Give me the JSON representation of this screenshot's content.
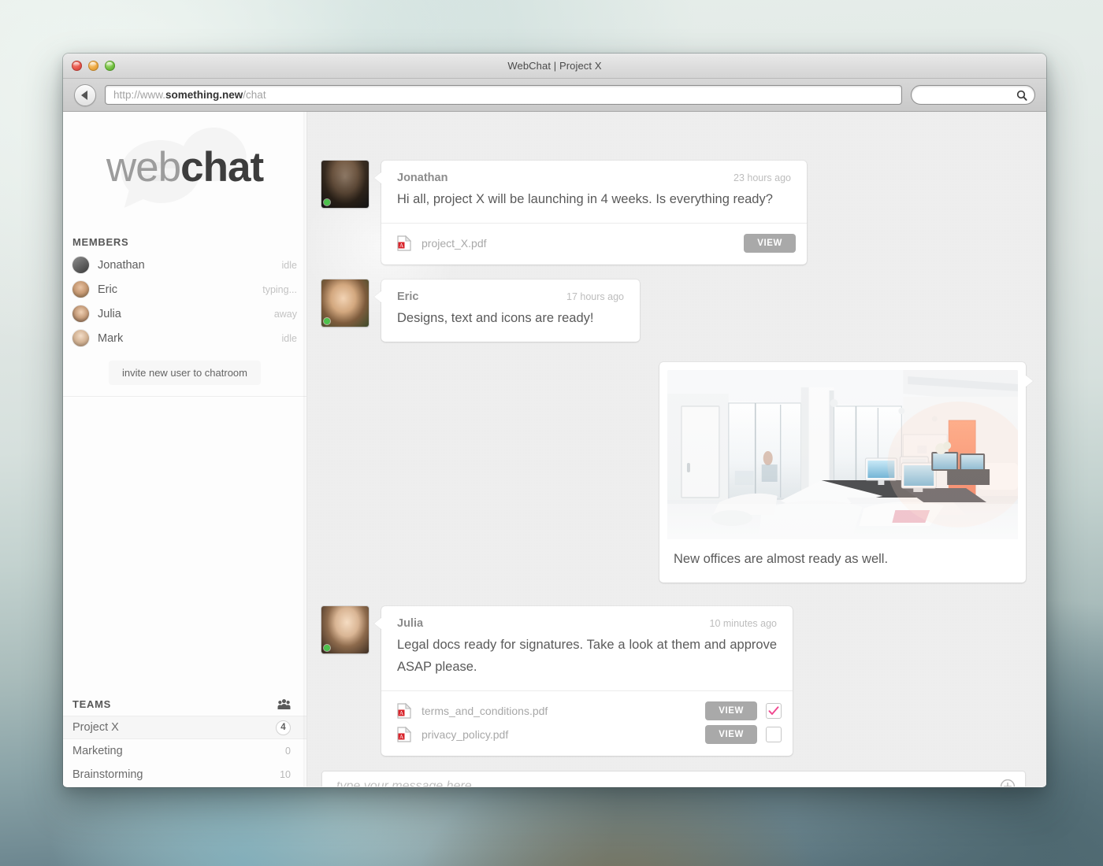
{
  "window": {
    "title": "WebChat | Project X",
    "controls": [
      "close",
      "minimize",
      "maximize"
    ]
  },
  "toolbar": {
    "back_label": "back-arrow",
    "url": {
      "prefix": "http://www.",
      "domain": "something.new",
      "path": "/chat",
      "full": "http://www.something.new/chat"
    },
    "search_placeholder": ""
  },
  "sidebar": {
    "logo": {
      "first": "web",
      "second": "chat"
    },
    "members_heading": "MEMBERS",
    "members": [
      {
        "name": "Jonathan",
        "status": "idle"
      },
      {
        "name": "Eric",
        "status": "typing..."
      },
      {
        "name": "Julia",
        "status": "away"
      },
      {
        "name": "Mark",
        "status": "idle"
      }
    ],
    "invite_label": "invite new user to chatroom",
    "teams_heading": "TEAMS",
    "teams": [
      {
        "name": "Project X",
        "count": "4",
        "active": true
      },
      {
        "name": "Marketing",
        "count": "0",
        "active": false
      },
      {
        "name": "Brainstorming",
        "count": "10",
        "active": false
      }
    ]
  },
  "chat": {
    "messages": [
      {
        "author": "Jonathan",
        "time": "23 hours ago",
        "text": "Hi all, project X will be launching in 4 weeks. Is everything ready?",
        "attachments": [
          {
            "filename": "project_X.pdf",
            "view_label": "VIEW",
            "has_checkbox": false
          }
        ]
      },
      {
        "author": "Eric",
        "time": "17 hours ago",
        "text": "Designs, text and icons are ready!",
        "attachments": []
      },
      {
        "type": "image",
        "caption": "New offices are almost ready as well.",
        "image_alt": "modern white office interior with desks and monitors"
      },
      {
        "author": "Julia",
        "time": "10 minutes ago",
        "text": "Legal docs ready for signatures. Take a look at them and approve ASAP please.",
        "attachments": [
          {
            "filename": "terms_and_conditions.pdf",
            "view_label": "VIEW",
            "has_checkbox": true,
            "checked": true
          },
          {
            "filename": "privacy_policy.pdf",
            "view_label": "VIEW",
            "has_checkbox": true,
            "checked": false
          }
        ]
      }
    ],
    "composer_placeholder": "type your message here...",
    "composer_value": ""
  },
  "colors": {
    "accent_check": "#f0478f",
    "online_dot": "#4cc14c",
    "view_button": "#a9a9a9",
    "pdf_red": "#d8232a",
    "logo_dark": "#3d3d3d",
    "logo_light": "#9c9c9c"
  }
}
